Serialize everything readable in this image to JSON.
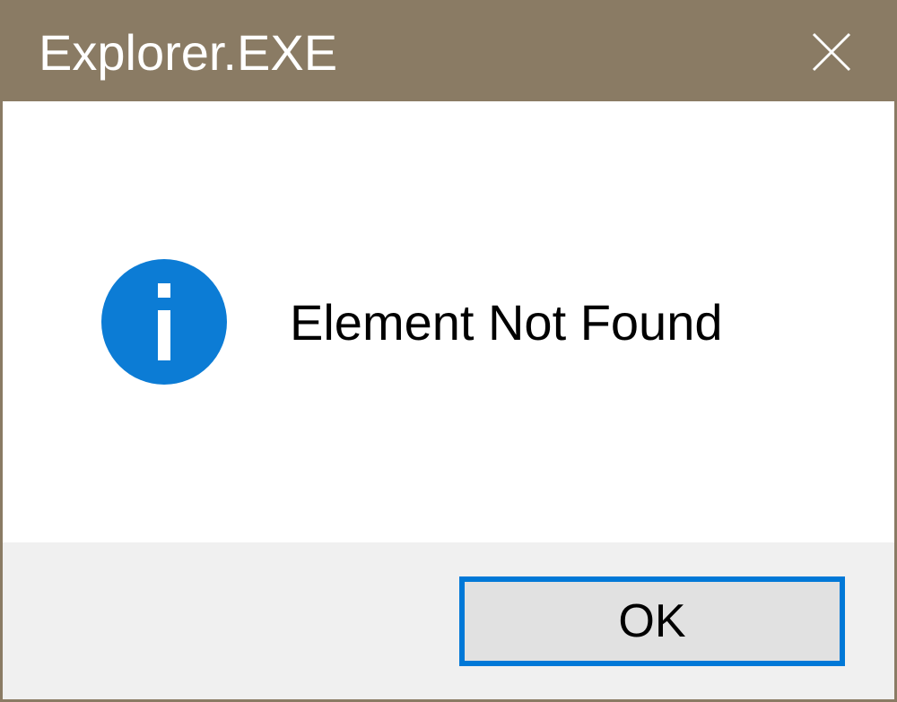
{
  "titlebar": {
    "title": "Explorer.EXE"
  },
  "content": {
    "message": "Element Not Found"
  },
  "buttons": {
    "ok_label": "OK"
  }
}
